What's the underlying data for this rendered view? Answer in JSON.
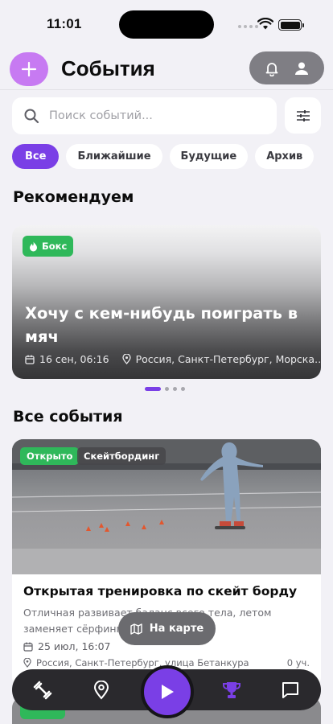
{
  "status_bar": {
    "time": "11:01"
  },
  "header": {
    "title": "События",
    "add_label": "+"
  },
  "search": {
    "placeholder": "Поиск событий...",
    "value": ""
  },
  "filters": [
    {
      "label": "Все",
      "active": true
    },
    {
      "label": "Ближайшие",
      "active": false
    },
    {
      "label": "Будущие",
      "active": false
    },
    {
      "label": "Архив",
      "active": false
    }
  ],
  "recommended": {
    "section_title": "Рекомендуем",
    "card": {
      "badge": "Бокс",
      "title": "Хочу с кем-нибудь поиграть в мяч",
      "date": "16 сен, 06:16",
      "location": "Россия, Санкт-Петербург, Морска…"
    },
    "pager": {
      "count": 4,
      "active": 0
    }
  },
  "all_events": {
    "section_title": "Все события",
    "card": {
      "status_badge": "Открыто",
      "sport_badge": "Скейтбординг",
      "title": "Открытая тренировка по скейт борду",
      "description": "Отличная развивает баланс всего тела, летом заменяет сёрфинг",
      "date": "25 июл, 16:07",
      "location": "Россия, Санкт-Петербург, улица Бетанкура",
      "participants": "0 уч."
    }
  },
  "map_button": {
    "label": "На карте"
  },
  "tabbar": {
    "items": [
      "workouts-icon",
      "map-pin-icon",
      "play-icon",
      "trophy-icon",
      "chat-icon"
    ],
    "active": "trophy-icon"
  },
  "colors": {
    "accent": "#7a3fe6",
    "add_button": "#c77af2",
    "badge_green": "#2fb85a",
    "tabbar": "#2a292d"
  }
}
